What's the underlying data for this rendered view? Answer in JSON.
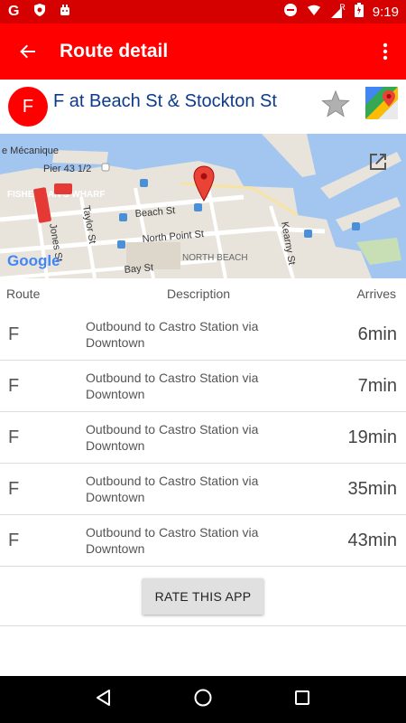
{
  "status_bar": {
    "time": "9:19",
    "signal_label": "R"
  },
  "app_bar": {
    "title": "Route detail"
  },
  "stop": {
    "route_letter": "F",
    "title": "F at Beach St & Stockton St"
  },
  "map": {
    "labels": {
      "mecanique": "e Mécanique",
      "pier": "Pier 43 1/2",
      "wharf": "FISHERMAN'S WHARF",
      "beach": "Beach St",
      "taylor": "Taylor St",
      "jones": "Jones St",
      "north_point": "North Point St",
      "north_beach": "NORTH BEACH",
      "bay": "Bay St",
      "kearny": "Kearny St",
      "google": "Google"
    }
  },
  "columns": {
    "route": "Route",
    "description": "Description",
    "arrives": "Arrives"
  },
  "arrivals": [
    {
      "route": "F",
      "description": "Outbound to Castro Station via Downtown",
      "arrives": "6min"
    },
    {
      "route": "F",
      "description": "Outbound to Castro Station via Downtown",
      "arrives": "7min"
    },
    {
      "route": "F",
      "description": "Outbound to Castro Station via Downtown",
      "arrives": "19min"
    },
    {
      "route": "F",
      "description": "Outbound to Castro Station via Downtown",
      "arrives": "35min"
    },
    {
      "route": "F",
      "description": "Outbound to Castro Station via Downtown",
      "arrives": "43min"
    }
  ],
  "rate_button": {
    "label": "RATE THIS APP"
  },
  "colors": {
    "app_red": "#ff0000",
    "status_red": "#d50000",
    "title_blue": "#0d3b8a"
  }
}
